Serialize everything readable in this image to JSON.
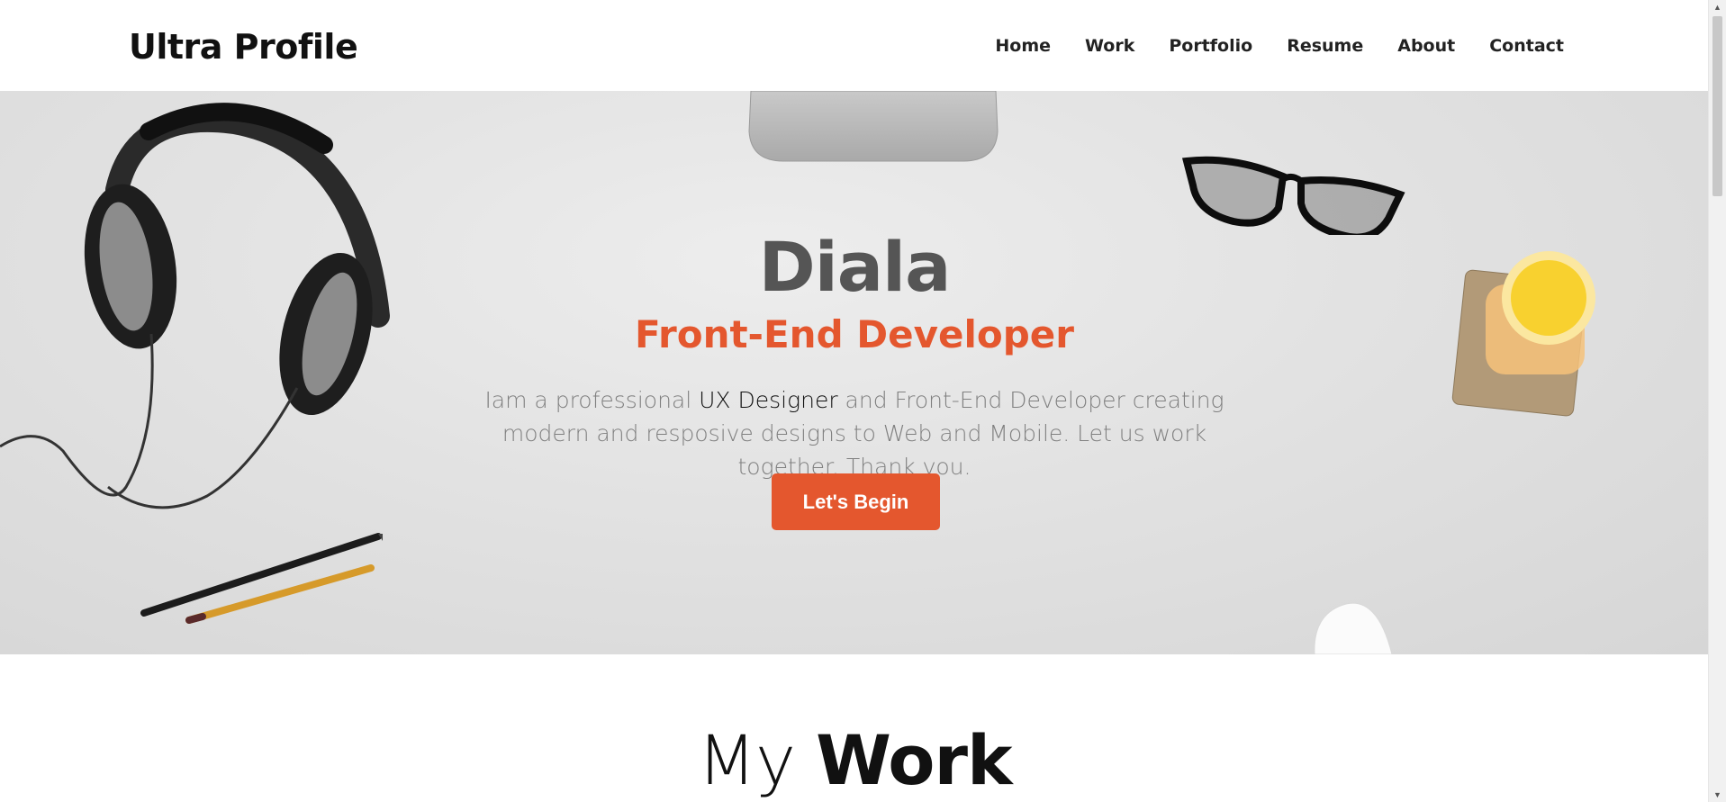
{
  "brand": "Ultra Profile",
  "nav": [
    "Home",
    "Work",
    "Portfolio",
    "Resume",
    "About",
    "Contact"
  ],
  "hero": {
    "name": "Diala",
    "role": "Front-End Developer",
    "desc_before": "Iam a professional ",
    "desc_highlight": "UX Designer",
    "desc_after": " and Front-End Developer creating modern and resposive designs to Web and Mobile. Let us work together. Thank you.",
    "cta": "Let's Begin"
  },
  "work": {
    "light": "My ",
    "bold": "Work"
  },
  "colors": {
    "accent": "#e4572e",
    "heading_gray": "#555555",
    "text_gray": "#808080"
  },
  "icons": [
    "headphones-icon",
    "glasses-icon",
    "pencil-icon",
    "juice-glass-icon",
    "mouse-icon",
    "monitor-stand-icon"
  ]
}
